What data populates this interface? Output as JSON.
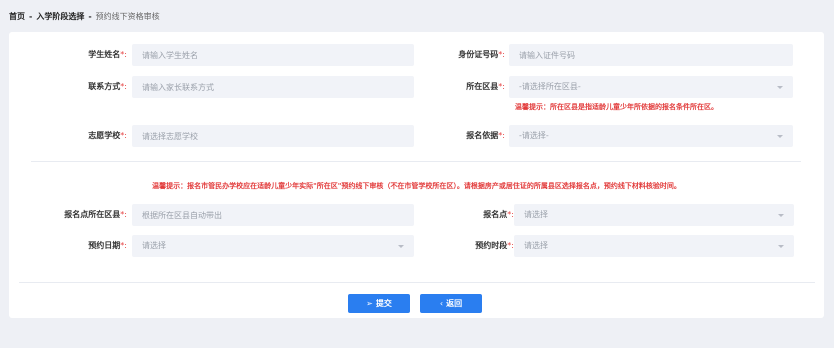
{
  "breadcrumb": {
    "home": "首页",
    "separator": "-",
    "stage": "入学阶段选择",
    "current": "预约线下资格审核"
  },
  "form": {
    "student_name": {
      "label": "学生姓名",
      "required": "*:",
      "placeholder": "请输入学生姓名"
    },
    "id_number": {
      "label": "身份证号码",
      "required": "*:",
      "placeholder": "请输入证件号码"
    },
    "contact": {
      "label": "联系方式",
      "required": "*:",
      "placeholder": "请输入家长联系方式"
    },
    "district": {
      "label": "所在区县",
      "required": "*:",
      "value": "-请选择所在区县-"
    },
    "district_hint": "温馨提示：所在区县是指适龄儿童少年所依据的报名条件所在区。",
    "school": {
      "label": "志愿学校",
      "required": "*:",
      "placeholder": "请选择志愿学校"
    },
    "basis": {
      "label": "报名依据",
      "required": "*:",
      "value": "-请选择-"
    },
    "notice": "温馨提示：报名市管民办学校应在适龄儿童少年实际\"所在区\"预约线下审核（不在市管学校所在区）。请根据房产或居住证的所属县区选择报名点，预约线下材料核验时间。",
    "reg_district": {
      "label": "报名点所在区县",
      "required": "*:",
      "placeholder": "根据所在区县自动带出"
    },
    "reg_point": {
      "label": "报名点",
      "required": "*:",
      "value": "请选择"
    },
    "appt_date": {
      "label": "预约日期",
      "required": "*:",
      "value": "请选择"
    },
    "appt_slot": {
      "label": "预约时段",
      "required": "*:",
      "value": "请选择"
    }
  },
  "actions": {
    "submit_label": "提交",
    "submit_icon": "send-icon",
    "back_label": "返回",
    "back_icon": "chevron-left-icon"
  },
  "colors": {
    "primary": "#2a7ef0",
    "required": "#e64545",
    "hint": "#e23b3b",
    "field_bg": "#f1f3f8",
    "page_bg": "#eef0f5"
  }
}
